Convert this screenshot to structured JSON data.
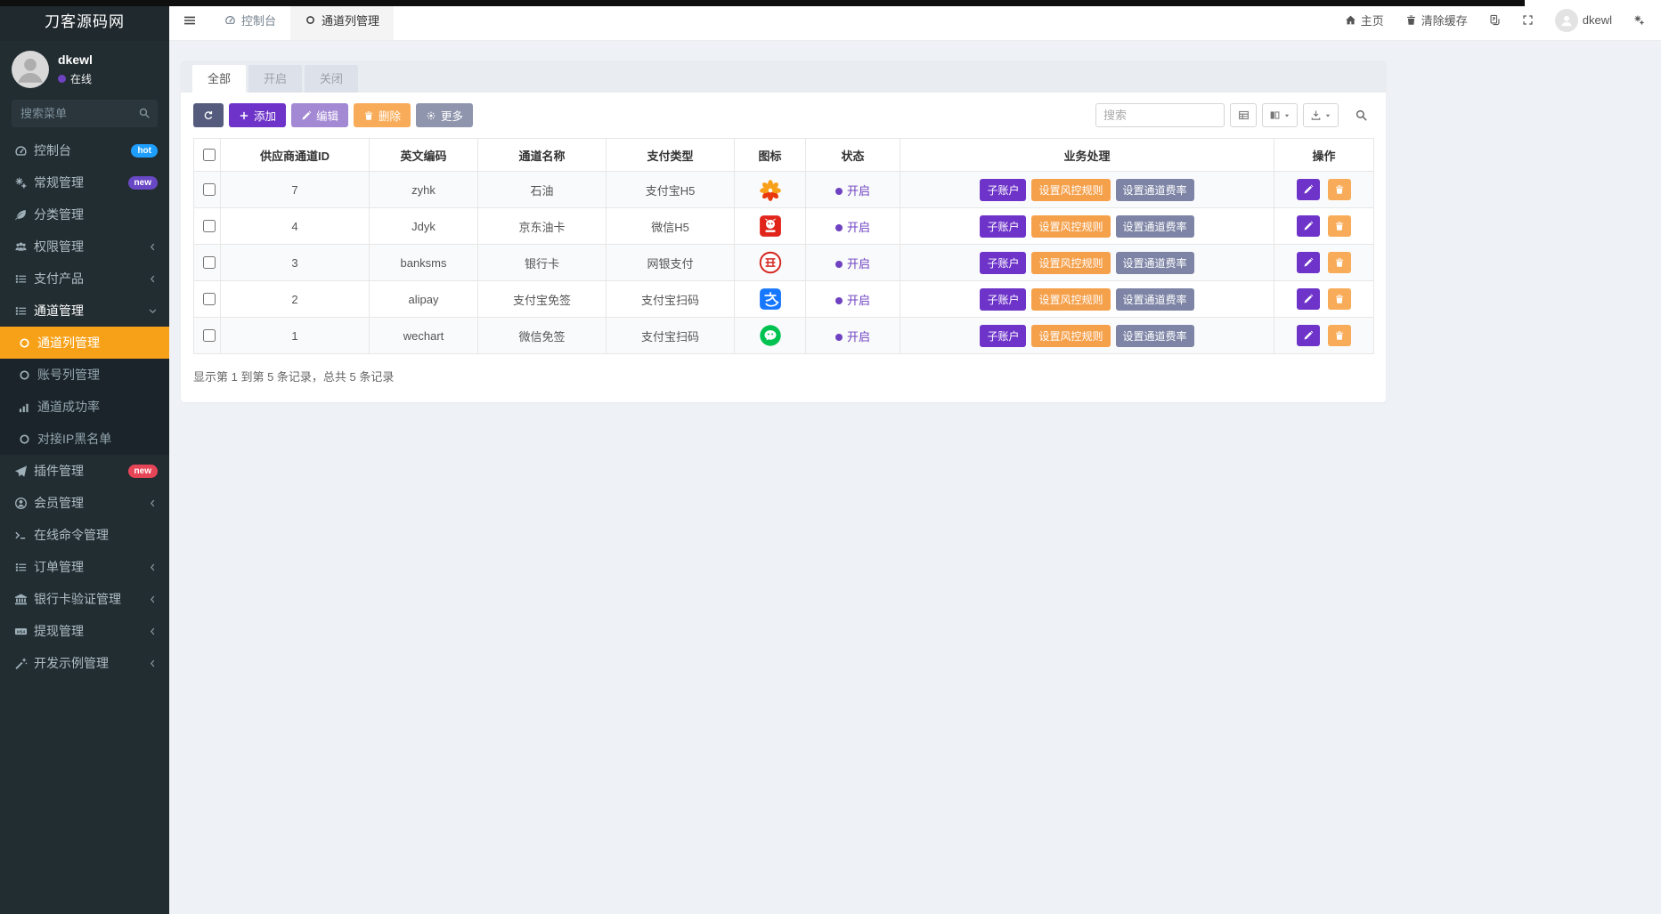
{
  "brand": "刀客源码网",
  "colors": {
    "sidebar_bg": "#222d32",
    "active_orange": "#f7a118",
    "purple": "#6e34c9",
    "light_purple": "#a389d4",
    "orange": "#f8ac59",
    "slate": "#7d84a5",
    "status_purple": "#6f42c1",
    "hot_badge": "#1e9fff",
    "new_badge_purple": "#6948c5",
    "new_badge_red": "#e64557"
  },
  "sidebar": {
    "user": {
      "name": "dkewl",
      "status": "在线"
    },
    "search_placeholder": "搜索菜单",
    "items": [
      {
        "key": "console",
        "label": "控制台",
        "icon": "gauge-icon",
        "badge": "hot",
        "badge_style": "blue"
      },
      {
        "key": "general",
        "label": "常规管理",
        "icon": "gears-icon",
        "badge": "new",
        "badge_style": "purple"
      },
      {
        "key": "category",
        "label": "分类管理",
        "icon": "leaf-icon"
      },
      {
        "key": "auth",
        "label": "权限管理",
        "icon": "users-icon",
        "chevron": "left"
      },
      {
        "key": "pay-product",
        "label": "支付产品",
        "icon": "list-icon",
        "chevron": "left"
      },
      {
        "key": "channel",
        "label": "通道管理",
        "icon": "list-icon",
        "chevron": "down",
        "open": true,
        "children": [
          {
            "key": "channel-list",
            "label": "通道列管理",
            "icon": "circle-icon",
            "active": true
          },
          {
            "key": "account-list",
            "label": "账号列管理",
            "icon": "circle-icon"
          },
          {
            "key": "channel-success-rate",
            "label": "通道成功率",
            "icon": "signal-icon"
          },
          {
            "key": "ip-blacklist",
            "label": "对接IP黑名单",
            "icon": "circle-icon"
          }
        ]
      },
      {
        "key": "addon",
        "label": "插件管理",
        "icon": "paper-plane-icon",
        "badge": "new",
        "badge_style": "red"
      },
      {
        "key": "member",
        "label": "会员管理",
        "icon": "user-circle-icon",
        "chevron": "left"
      },
      {
        "key": "online-command",
        "label": "在线命令管理",
        "icon": "terminal-icon"
      },
      {
        "key": "order",
        "label": "订单管理",
        "icon": "list-icon",
        "chevron": "left"
      },
      {
        "key": "bankcard-verify",
        "label": "银行卡验证管理",
        "icon": "bank-icon",
        "chevron": "left"
      },
      {
        "key": "withdraw",
        "label": "提现管理",
        "icon": "visa-icon",
        "chevron": "left"
      },
      {
        "key": "dev-example",
        "label": "开发示例管理",
        "icon": "magic-icon",
        "chevron": "left"
      }
    ]
  },
  "navbar": {
    "tabs": [
      {
        "label": "控制台",
        "icon": "gauge-icon",
        "active": false
      },
      {
        "label": "通道列管理",
        "icon": "circle-icon",
        "active": true
      }
    ],
    "home": "主页",
    "clear_cache": "清除缓存",
    "user": "dkewl"
  },
  "page": {
    "filter_tabs": [
      "全部",
      "开启",
      "关闭"
    ],
    "toolbar": {
      "add": "添加",
      "edit": "编辑",
      "delete": "删除",
      "more": "更多"
    },
    "search_placeholder": "搜索",
    "table": {
      "headers": [
        "供应商通道ID",
        "英文编码",
        "通道名称",
        "支付类型",
        "图标",
        "状态",
        "业务处理",
        "操作"
      ],
      "rows": [
        {
          "id": "7",
          "code": "zyhk",
          "name": "石油",
          "pay_type": "支付宝H5",
          "icon": "petrochina-icon",
          "status": "开启",
          "actions": [
            "子账户",
            "设置风控规则",
            "设置通道费率"
          ]
        },
        {
          "id": "4",
          "code": "Jdyk",
          "name": "京东油卡",
          "pay_type": "微信H5",
          "icon": "jd-icon",
          "status": "开启",
          "actions": [
            "子账户",
            "设置风控规则",
            "设置通道费率"
          ]
        },
        {
          "id": "3",
          "code": "banksms",
          "name": "银行卡",
          "pay_type": "网银支付",
          "icon": "bank-badge-icon",
          "status": "开启",
          "actions": [
            "子账户",
            "设置风控规则",
            "设置通道费率"
          ]
        },
        {
          "id": "2",
          "code": "alipay",
          "name": "支付宝免签",
          "pay_type": "支付宝扫码",
          "icon": "alipay-icon",
          "status": "开启",
          "actions": [
            "子账户",
            "设置风控规则",
            "设置通道费率"
          ]
        },
        {
          "id": "1",
          "code": "wechart",
          "name": "微信免签",
          "pay_type": "支付宝扫码",
          "icon": "wechat-icon",
          "status": "开启",
          "actions": [
            "子账户",
            "设置风控规则",
            "设置通道费率"
          ]
        }
      ]
    },
    "footer": "显示第 1 到第 5 条记录，总共 5 条记录"
  }
}
